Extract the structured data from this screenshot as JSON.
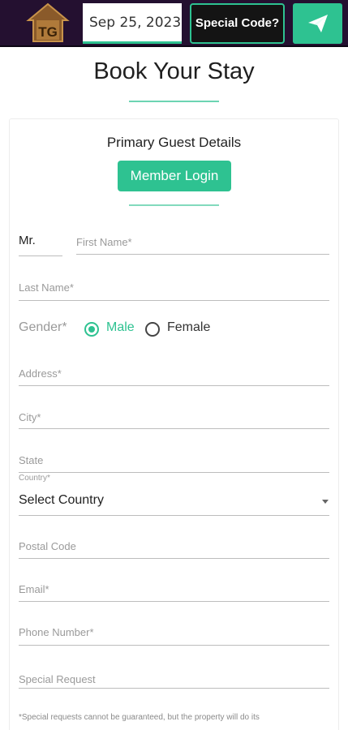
{
  "header": {
    "logo_text": "TG",
    "date": "Sep 25, 2023 -",
    "special_code_label": "Special Code?"
  },
  "page_title": "Book Your Stay",
  "section_title": "Primary Guest Details",
  "member_login_label": "Member Login",
  "form": {
    "salutation": "Mr.",
    "first_name_placeholder": "First Name*",
    "last_name_placeholder": "Last Name*",
    "gender_label": "Gender*",
    "gender_options": [
      "Male",
      "Female"
    ],
    "gender_selected": "Male",
    "address_placeholder": "Address*",
    "city_placeholder": "City*",
    "state_placeholder": "State",
    "country_label": "Country*",
    "country_value": "Select Country",
    "postal_placeholder": "Postal Code",
    "email_placeholder": "Email*",
    "phone_placeholder": "Phone Number*",
    "special_request_placeholder": "Special Request",
    "footnote": "*Special requests cannot be guaranteed, but the property will do its"
  },
  "colors": {
    "accent": "#2ec291",
    "topbar": "#241030"
  },
  "icons": {
    "logo": "house-logo-icon",
    "send": "paper-plane-icon",
    "dropdown": "caret-down-icon"
  }
}
